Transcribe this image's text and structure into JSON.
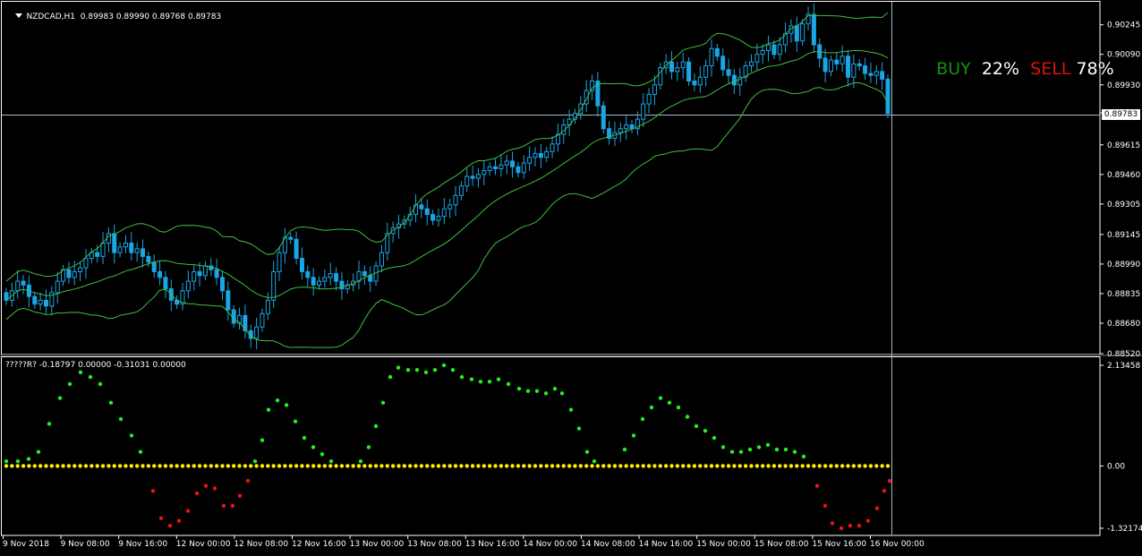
{
  "window": {
    "symbol_label": "NZDCAD,H1",
    "ohlc": "0.89983 0.89990 0.89768 0.89783"
  },
  "indicator": {
    "label": "?????R? -0.18797 0.00000 -0.31031 0.00000",
    "ticks": [
      "2.13458",
      "0.00",
      "-1.32174"
    ]
  },
  "overlay": {
    "buy_label": "BUY",
    "buy_pct": "22%",
    "sell_label": "SELL",
    "sell_pct": "78%"
  },
  "current_price": "0.89783",
  "price_ticks": [
    "0.90245",
    "0.90090",
    "0.89930",
    "0.89783",
    "0.89615",
    "0.89460",
    "0.89305",
    "0.89145",
    "0.88990",
    "0.88835",
    "0.88680",
    "0.88520"
  ],
  "time_ticks": [
    "9 Nov 2018",
    "9 Nov 08:00",
    "9 Nov 16:00",
    "12 Nov 00:00",
    "12 Nov 08:00",
    "12 Nov 16:00",
    "13 Nov 00:00",
    "13 Nov 08:00",
    "13 Nov 16:00",
    "14 Nov 00:00",
    "14 Nov 08:00",
    "14 Nov 16:00",
    "15 Nov 00:00",
    "15 Nov 08:00",
    "15 Nov 16:00",
    "16 Nov 00:00"
  ],
  "colors": {
    "background": "#000000",
    "candle": "#1aa6e6",
    "band": "#3fbf3f",
    "grid_line": "#a9b8c8",
    "positive_dot": "#22ee22",
    "negative_dot": "#ee1111",
    "zero_dot": "#ffee00",
    "buy": "#139013",
    "sell": "#e01010"
  },
  "chart_data": {
    "type": "candlestick",
    "symbol": "NZDCAD",
    "timeframe": "H1",
    "ylim": [
      0.8852,
      0.903
    ],
    "closes": [
      0.888,
      0.8885,
      0.889,
      0.8888,
      0.8882,
      0.8878,
      0.888,
      0.8877,
      0.8884,
      0.889,
      0.8896,
      0.8892,
      0.8895,
      0.8897,
      0.8902,
      0.8905,
      0.8903,
      0.891,
      0.8915,
      0.8905,
      0.8908,
      0.891,
      0.8905,
      0.8907,
      0.8903,
      0.89,
      0.8895,
      0.8892,
      0.8886,
      0.888,
      0.8878,
      0.8885,
      0.889,
      0.8895,
      0.8893,
      0.8898,
      0.8896,
      0.8892,
      0.8885,
      0.8875,
      0.8868,
      0.8872,
      0.8864,
      0.886,
      0.8866,
      0.8873,
      0.888,
      0.8895,
      0.8905,
      0.8913,
      0.8912,
      0.8902,
      0.8895,
      0.8892,
      0.8888,
      0.889,
      0.8892,
      0.8894,
      0.889,
      0.8886,
      0.8888,
      0.889,
      0.8895,
      0.8893,
      0.889,
      0.8898,
      0.8905,
      0.8915,
      0.8918,
      0.892,
      0.8922,
      0.8925,
      0.893,
      0.8928,
      0.8925,
      0.8922,
      0.8924,
      0.8928,
      0.893,
      0.8935,
      0.894,
      0.8945,
      0.8944,
      0.8946,
      0.8948,
      0.895,
      0.8949,
      0.8951,
      0.8953,
      0.895,
      0.8947,
      0.8952,
      0.8955,
      0.8957,
      0.8955,
      0.8958,
      0.8962,
      0.8967,
      0.8972,
      0.8975,
      0.8978,
      0.8983,
      0.899,
      0.8995,
      0.8982,
      0.897,
      0.8965,
      0.8968,
      0.897,
      0.8972,
      0.897,
      0.8975,
      0.8983,
      0.8988,
      0.8993,
      0.9002,
      0.9005,
      0.9,
      0.9002,
      0.9005,
      0.8995,
      0.8993,
      0.8997,
      0.9003,
      0.9012,
      0.9008,
      0.9001,
      0.8998,
      0.8993,
      0.8997,
      0.9003,
      0.9005,
      0.9009,
      0.9011,
      0.9014,
      0.9009,
      0.9014,
      0.902,
      0.9024,
      0.9016,
      0.9025,
      0.903,
      0.9014,
      0.9007,
      0.9,
      0.9006,
      0.9004,
      0.9008,
      0.8997,
      0.9004,
      0.9003,
      0.8999,
      0.8998,
      0.9,
      0.8996,
      0.8978
    ],
    "bands": "Bollinger-style envelope (upper, middle, lower)",
    "indicator_ylim": [
      -1.32174,
      2.13458
    ]
  }
}
